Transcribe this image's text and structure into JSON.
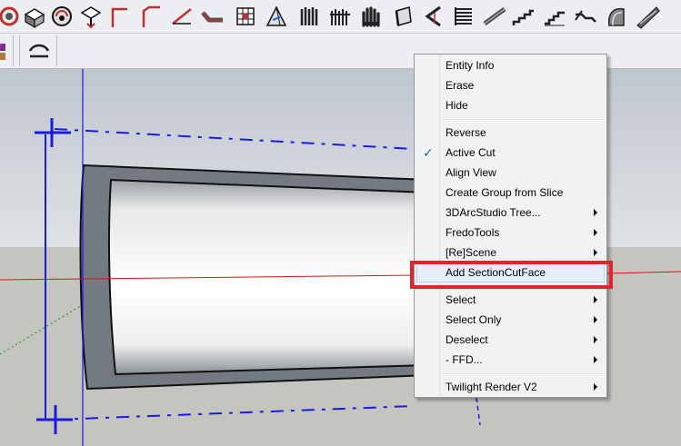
{
  "toolbar": {
    "icons": [
      "rotate-icon",
      "box-icon",
      "orbit-icon",
      "push-pull-icon",
      "line-icon",
      "corner-line-icon",
      "angle-line-icon",
      "bend-icon",
      "table-icon",
      "pyramid-icon",
      "column-icon",
      "rail-icon",
      "glove-icon",
      "panel-icon",
      "chevron-tool-icon",
      "stack-icon",
      "stair-icon",
      "stair-2-icon",
      "stair-3-icon",
      "stair-4-icon",
      "shell-icon",
      "ramp-icon"
    ],
    "second_row_icons": [
      "paint-icon",
      "arch-icon"
    ]
  },
  "context_menu": {
    "items": [
      {
        "label": "Entity Info"
      },
      {
        "label": "Erase"
      },
      {
        "label": "Hide"
      },
      {
        "label": "Reverse"
      },
      {
        "label": "Active Cut",
        "checked": true
      },
      {
        "label": "Align View"
      },
      {
        "label": "Create Group from Slice"
      },
      {
        "label": "3DArcStudio Tree...",
        "submenu": true
      },
      {
        "label": "FredoTools",
        "submenu": true
      },
      {
        "label": "[Re]Scene",
        "submenu": true
      },
      {
        "label": "Add SectionCutFace",
        "highlighted": true
      },
      {
        "label": "Select",
        "submenu": true
      },
      {
        "label": "Select Only",
        "submenu": true
      },
      {
        "label": "Deselect",
        "submenu": true
      },
      {
        "label": "- FFD...",
        "submenu": true
      },
      {
        "label": "Twilight Render V2",
        "submenu": true
      }
    ],
    "checkmark": "✓"
  },
  "colors": {
    "highlight_border": "#e0242a",
    "section_plane": "#1a1ae6",
    "red_axis": "#d01818",
    "green_axis": "#1e8a1e"
  }
}
